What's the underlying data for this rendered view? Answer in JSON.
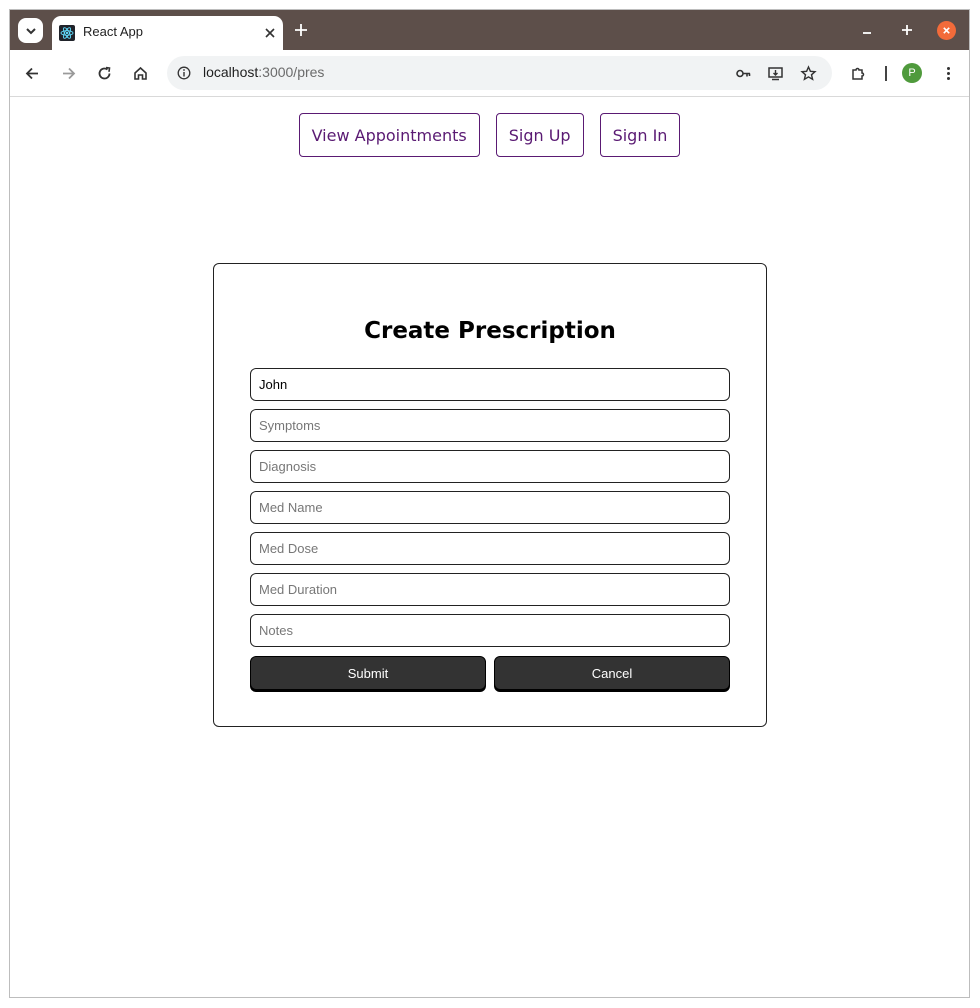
{
  "browser": {
    "tab_title": "React App",
    "url_host": "localhost",
    "url_rest": ":3000/pres",
    "profile_initial": "P"
  },
  "nav": {
    "view_appointments": "View Appointments",
    "sign_up": "Sign Up",
    "sign_in": "Sign In",
    "accent_color": "#5a1a73"
  },
  "form": {
    "title": "Create Prescription",
    "fields": [
      {
        "value": "John",
        "placeholder": ""
      },
      {
        "value": "",
        "placeholder": "Symptoms"
      },
      {
        "value": "",
        "placeholder": "Diagnosis"
      },
      {
        "value": "",
        "placeholder": "Med Name"
      },
      {
        "value": "",
        "placeholder": "Med Dose"
      },
      {
        "value": "",
        "placeholder": "Med Duration"
      },
      {
        "value": "",
        "placeholder": "Notes"
      }
    ],
    "submit_label": "Submit",
    "cancel_label": "Cancel",
    "button_color": "#333333"
  },
  "icons": {
    "tab_search": "chevron-down-icon",
    "favicon": "react-logo-icon",
    "back": "back-arrow-icon",
    "forward": "forward-arrow-icon",
    "reload": "reload-icon",
    "home": "home-icon",
    "info": "info-icon",
    "password": "key-icon",
    "install": "install-icon",
    "bookmark": "star-icon",
    "extensions": "puzzle-icon",
    "menu": "kebab-menu-icon"
  }
}
